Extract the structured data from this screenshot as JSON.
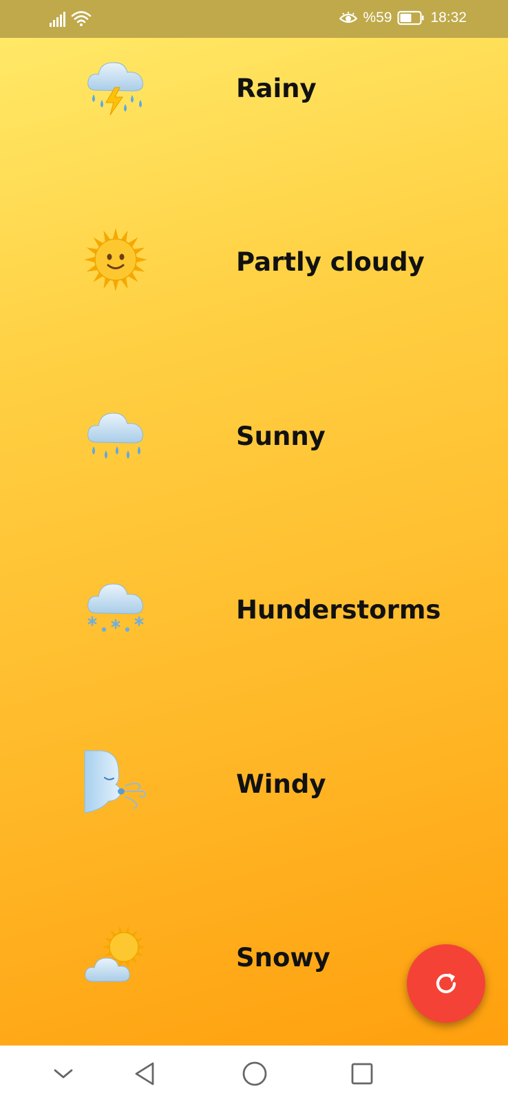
{
  "status_bar": {
    "signal_icon": "signal-icon",
    "wifi_icon": "wifi-icon",
    "eye_icon": "eye-comfort-icon",
    "battery_percent": "%59",
    "battery_icon": "battery-icon",
    "battery_level": 0.59,
    "time": "18:32"
  },
  "weather_items": [
    {
      "label": "Rainy",
      "icon": "cloud-lightning-rain-icon"
    },
    {
      "label": "Partly cloudy",
      "icon": "sun-with-face-icon"
    },
    {
      "label": "Sunny",
      "icon": "cloud-rain-icon"
    },
    {
      "label": "Hunderstorms",
      "icon": "cloud-snow-icon"
    },
    {
      "label": "Windy",
      "icon": "wind-face-icon"
    },
    {
      "label": "Snowy",
      "icon": "sun-behind-cloud-icon"
    }
  ],
  "fab": {
    "icon": "refresh-icon"
  },
  "nav_bar": {
    "items": [
      {
        "icon": "chevron-down-icon"
      },
      {
        "icon": "back-triangle-icon"
      },
      {
        "icon": "home-circle-icon"
      },
      {
        "icon": "recents-square-icon"
      }
    ]
  },
  "colors": {
    "status_bar": "#bfa94a",
    "gradient_top": "#ffeb6b",
    "gradient_bottom": "#ff9c0a",
    "fab": "#f44336",
    "label": "#111111"
  }
}
